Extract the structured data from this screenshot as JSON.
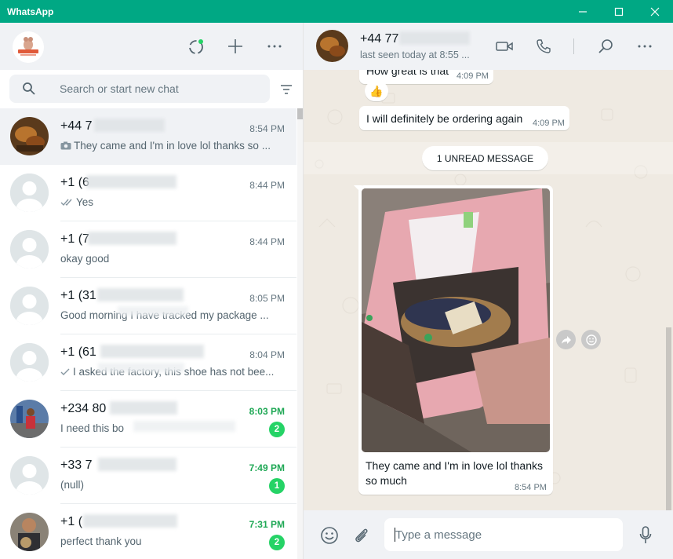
{
  "window": {
    "title": "WhatsApp"
  },
  "sidebar": {
    "search_placeholder": "Search or start new chat",
    "chats": [
      {
        "name": "+44 7",
        "time": "8:54 PM",
        "preview": "They came and I'm in love lol thanks so ...",
        "preview_icon": "camera-icon",
        "unread": "",
        "active": true
      },
      {
        "name": "+1 (6",
        "time": "8:44 PM",
        "preview": "Yes",
        "preview_icon": "double-check-icon",
        "unread": ""
      },
      {
        "name": "+1 (7",
        "time": "8:44 PM",
        "preview": "okay good",
        "preview_icon": "",
        "unread": ""
      },
      {
        "name": "+1 (31",
        "time": "8:05 PM",
        "preview": "Good morning I have tracked my package ...",
        "preview_icon": "",
        "unread": ""
      },
      {
        "name": "+1 (61",
        "time": "8:04 PM",
        "preview": "I asked the factory, this shoe has not bee...",
        "preview_icon": "single-check-icon",
        "unread": ""
      },
      {
        "name": "+234 80",
        "time": "8:03 PM",
        "preview": "I need this bo",
        "preview_icon": "",
        "unread": "2"
      },
      {
        "name": "+33 7",
        "time": "7:49 PM",
        "preview": "(null)",
        "preview_icon": "",
        "unread": "1"
      },
      {
        "name": "+1 (",
        "time": "7:31 PM",
        "preview": "perfect thank you",
        "preview_icon": "",
        "unread": "2"
      }
    ]
  },
  "conversation": {
    "contact_name": "+44 77",
    "contact_status": "last seen today at 8:55 ...",
    "messages": [
      {
        "text": "How great is that",
        "time": "4:09 PM"
      },
      {
        "text": "👍",
        "time": ""
      },
      {
        "text": "I will definitely be ordering again",
        "time": "4:09 PM"
      }
    ],
    "unread_divider": "1 UNREAD MESSAGE",
    "photo_message": {
      "caption_line1": "They came and I'm in love lol thanks",
      "caption_line2": "so much",
      "time": "8:54 PM"
    },
    "composer_placeholder": "Type a message"
  },
  "colors": {
    "accent": "#00a884",
    "unread_green": "#25d366",
    "chat_bg": "#efeae2"
  }
}
